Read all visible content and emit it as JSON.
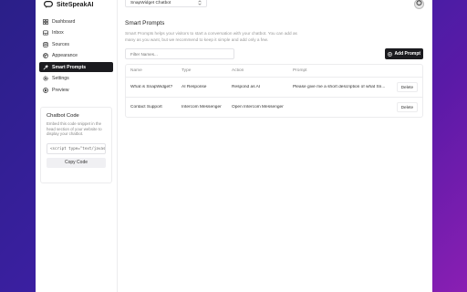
{
  "brand": {
    "name": "SiteSpeakAI"
  },
  "sidebar": {
    "items": [
      {
        "label": "Dashboard",
        "icon": "dashboard-icon"
      },
      {
        "label": "Inbox",
        "icon": "inbox-icon"
      },
      {
        "label": "Sources",
        "icon": "sources-icon"
      },
      {
        "label": "Appearance",
        "icon": "appearance-icon"
      },
      {
        "label": "Smart Prompts",
        "icon": "smart-prompts-icon",
        "active": true
      },
      {
        "label": "Settings",
        "icon": "gear-icon"
      },
      {
        "label": "Preview",
        "icon": "preview-icon"
      }
    ],
    "chatbot_code": {
      "title": "Chatbot Code",
      "description": "Embed this code snippet in the head section of your website to display your chatbot.",
      "snippet": "<script type=\"text/javascript",
      "copy_label": "Copy Code"
    }
  },
  "header": {
    "chatbot_select": "SnapWidget Chatbot"
  },
  "main": {
    "title": "Smart Prompts",
    "description": "Smart Prompts helps your visitors to start a conversation with your chatbot. You can add as many as you want, but we recommend to keep it simple and add only a few.",
    "filter_placeholder": "Filter Names...",
    "add_button": "Add Prompt",
    "table": {
      "headers": [
        "Name",
        "Type",
        "Action",
        "Prompt"
      ],
      "rows": [
        {
          "name": "What is SnapWidget?",
          "type": "AI Response",
          "action": "Respond as AI",
          "prompt": "Please give me a short description of what Sn...",
          "delete": "Delete"
        },
        {
          "name": "Contact Support",
          "type": "Intercom Messenger",
          "action": "Open Intercom Messenger",
          "prompt": "",
          "delete": "Delete"
        }
      ]
    }
  },
  "colors": {
    "accent_dark": "#1b1b1f",
    "background_gradient_start": "#2a1f88",
    "background_gradient_end": "#8a1fb3"
  }
}
